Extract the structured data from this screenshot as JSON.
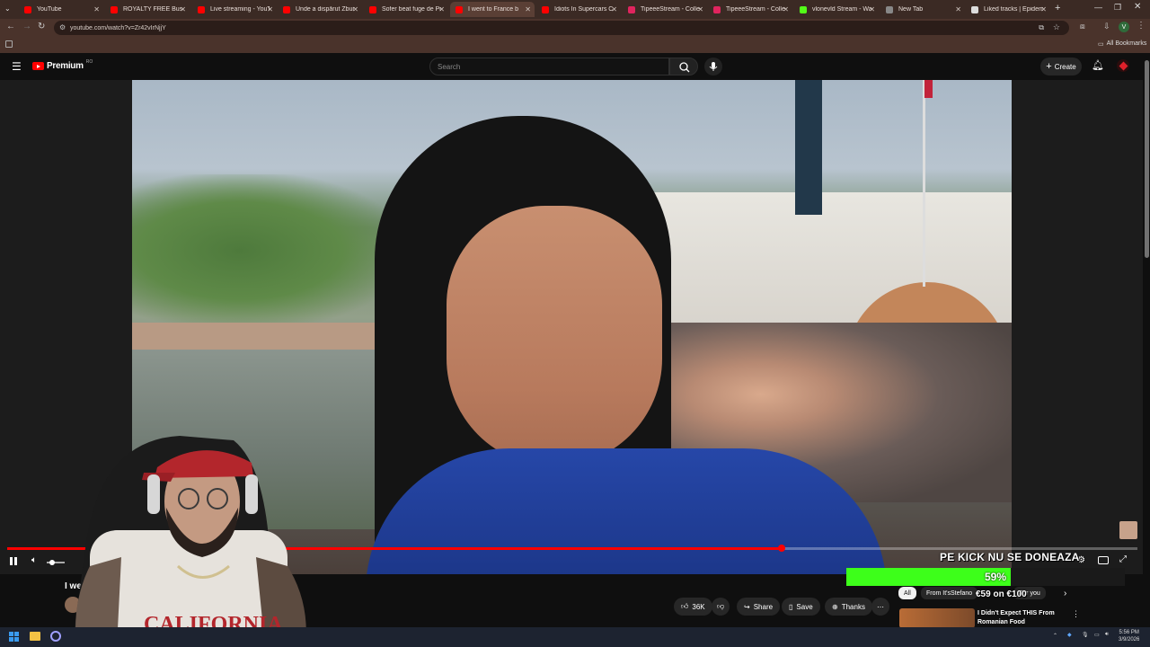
{
  "browser": {
    "tabs": [
      {
        "label": "YouTube",
        "color": "#ff0000"
      },
      {
        "label": "ROYALTY FREE Busines",
        "color": "#ff0000"
      },
      {
        "label": "Live streaming - YouTu",
        "color": "#ff0000"
      },
      {
        "label": "Unde a dispărut Zburg",
        "color": "#ff0000"
      },
      {
        "label": "Sofer beat fuge de Pol",
        "color": "#ff0000"
      },
      {
        "label": "I went to France b",
        "color": "#ff0000",
        "active": true
      },
      {
        "label": "Idiots In Supercars Ca",
        "color": "#ff0000"
      },
      {
        "label": "TipeeeStream - Collect",
        "color": "#e0245e"
      },
      {
        "label": "TipeeeStream - Collect",
        "color": "#e0245e"
      },
      {
        "label": "vlonevld Stream - Wat",
        "color": "#53fc18"
      },
      {
        "label": "New Tab",
        "color": "#888888"
      },
      {
        "label": "Liked tracks | Epidem",
        "color": "#dddddd"
      }
    ],
    "url": "youtube.com/watch?v=Zr42vIrNjjY",
    "all_bookmarks": "All Bookmarks"
  },
  "youtube": {
    "logo_text": "Premium",
    "logo_badge": "RO",
    "search_placeholder": "Search",
    "create_label": "Create",
    "video_title_partial": "I went",
    "likes": "36K",
    "share_label": "Share",
    "save_label": "Save",
    "thanks_label": "Thanks",
    "chips": [
      "All",
      "From It'sStefano",
      "For you"
    ],
    "rec_title_line1": "I Didn't Expect THIS From",
    "rec_title_line2": "Romanian Food",
    "progress_fraction": 0.685
  },
  "overlay": {
    "title": "PE KICK NU SE DONEAZA",
    "percent": "59%",
    "percent_value": 0.59,
    "amount": "€59 on €100"
  },
  "taskbar": {
    "time": "5:56 PM",
    "date": "3/9/2026"
  },
  "colors": {
    "accent": "#ff0000",
    "donate": "#3dff1a",
    "chrome": "#3b2a24"
  }
}
